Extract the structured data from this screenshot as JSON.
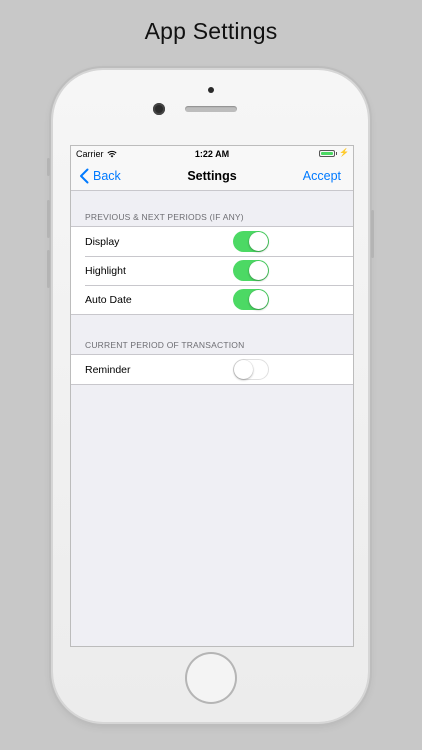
{
  "headline": "App Settings",
  "status_bar": {
    "carrier": "Carrier",
    "time": "1:22 AM"
  },
  "navbar": {
    "back_label": "Back",
    "title": "Settings",
    "accept_label": "Accept"
  },
  "sections": [
    {
      "header": "PREVIOUS & NEXT PERIODS (IF ANY)",
      "rows": [
        {
          "label": "Display",
          "on": true
        },
        {
          "label": "Highlight",
          "on": true
        },
        {
          "label": "Auto Date",
          "on": true
        }
      ]
    },
    {
      "header": "CURRENT PERIOD OF TRANSACTION",
      "rows": [
        {
          "label": "Reminder",
          "on": false
        }
      ]
    }
  ],
  "colors": {
    "accent": "#007aff",
    "switch_on": "#4cd964",
    "background": "#efeff4"
  },
  "icons": {
    "wifi": "wifi-icon",
    "battery": "battery-icon",
    "charging": "bolt-icon",
    "back": "chevron-left-icon"
  }
}
